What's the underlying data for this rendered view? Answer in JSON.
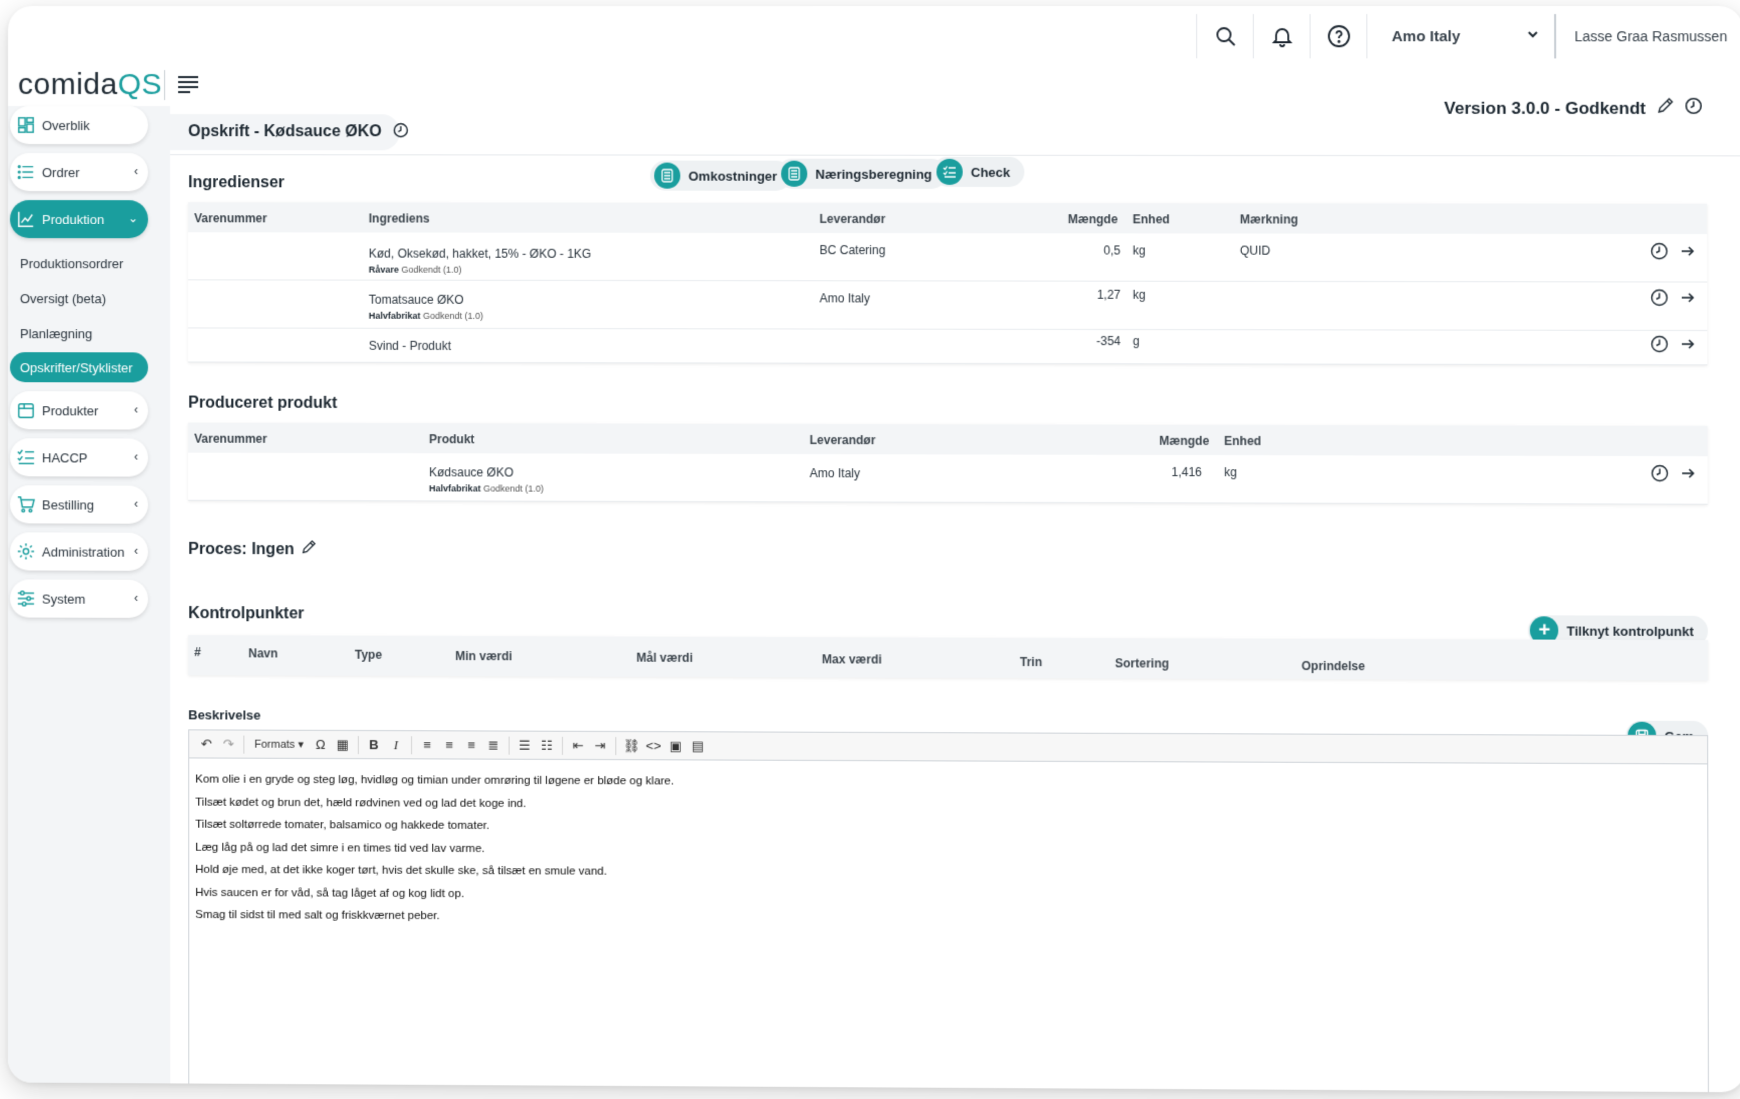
{
  "topbar": {
    "company": "Amo Italy",
    "user": "Lasse Graa Rasmussen"
  },
  "logo": {
    "part1": "comida",
    "part2": "QS"
  },
  "sidebar": {
    "items": [
      {
        "label": "Overblik",
        "icon": "dashboard-icon"
      },
      {
        "label": "Ordrer",
        "icon": "list-icon"
      },
      {
        "label": "Produktion",
        "icon": "chart-icon"
      },
      {
        "label": "Produkter",
        "icon": "box-icon"
      },
      {
        "label": "HACCP",
        "icon": "checklist-icon"
      },
      {
        "label": "Bestilling",
        "icon": "cart-icon"
      },
      {
        "label": "Administration",
        "icon": "gear-icon"
      },
      {
        "label": "System",
        "icon": "sliders-icon"
      }
    ],
    "sub": [
      "Produktionsordrer",
      "Oversigt (beta)",
      "Planlægning",
      "Opskrifter/Styklister"
    ]
  },
  "page": {
    "title": "Opskrift - Kødsauce ØKO",
    "version": "Version 3.0.0 - Godkendt"
  },
  "actions": {
    "costs": "Omkostninger",
    "nutrition": "Næringsberegning",
    "check": "Check"
  },
  "ingredients": {
    "title": "Ingredienser",
    "headers": {
      "varenummer": "Varenummer",
      "ingrediens": "Ingrediens",
      "leverandor": "Leverandør",
      "maengde": "Mængde",
      "enhed": "Enhed",
      "maerkning": "Mærkning"
    },
    "rows": [
      {
        "name": "Kød, Oksekød, hakket, 15% - ØKO - 1KG",
        "type": "Råvare",
        "status": "Godkendt (1.0)",
        "supplier": "BC Catering",
        "qty": "0,5",
        "unit": "kg",
        "label": "QUID"
      },
      {
        "name": "Tomatsauce ØKO",
        "type": "Halvfabrikat",
        "status": "Godkendt (1.0)",
        "supplier": "Amo Italy",
        "qty": "1,27",
        "unit": "kg",
        "label": ""
      },
      {
        "name": "Svind - Produkt",
        "type": "",
        "status": "",
        "supplier": "",
        "qty": "-354",
        "unit": "g",
        "label": ""
      }
    ]
  },
  "produced": {
    "title": "Produceret produkt",
    "headers": {
      "varenummer": "Varenummer",
      "produkt": "Produkt",
      "leverandor": "Leverandør",
      "maengde": "Mængde",
      "enhed": "Enhed"
    },
    "rows": [
      {
        "name": "Kødsauce ØKO",
        "type": "Halvfabrikat",
        "status": "Godkendt (1.0)",
        "supplier": "Amo Italy",
        "qty": "1,416",
        "unit": "kg"
      }
    ]
  },
  "process": {
    "title": "Proces: Ingen"
  },
  "checkpoints": {
    "title": "Kontrolpunkter",
    "attach": "Tilknyt kontrolpunkt",
    "headers": [
      "#",
      "Navn",
      "Type",
      "Min værdi",
      "Mål værdi",
      "Max værdi",
      "Trin",
      "Sortering",
      "Oprindelse"
    ]
  },
  "description": {
    "title": "Beskrivelse",
    "save": "Gem",
    "formats": "Formats",
    "lines": [
      "Kom olie i en gryde og steg løg, hvidløg og timian under omrøring til løgene er bløde og klare.",
      "Tilsæt kødet og brun det, hæld rødvinen ved og lad det koge ind.",
      "Tilsæt soltørrede tomater, balsamico og hakkede tomater.",
      "Læg låg på og lad det simre i en times tid ved lav varme.",
      "Hold øje med, at det ikke koger tørt, hvis det skulle ske, så tilsæt en smule vand.",
      "Hvis saucen er for våd, så tag låget af og kog lidt op.",
      "Smag til sidst til med salt og friskkværnet peber."
    ]
  },
  "colors": {
    "accent": "#1a9e9e",
    "sidebar_bg": "#f3f5f7"
  }
}
